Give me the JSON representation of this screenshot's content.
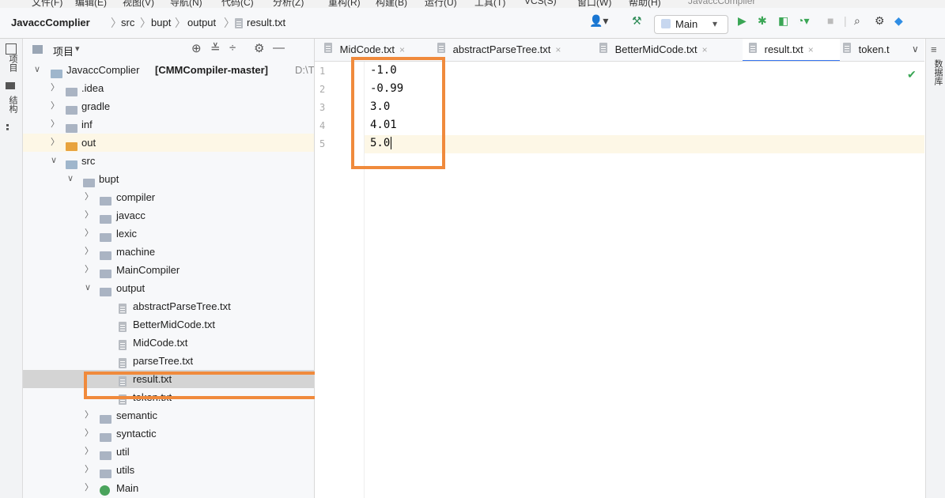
{
  "menubar": {
    "items": [
      "文件(F)",
      "编辑(E)",
      "视图(V)",
      "导航(N)",
      "代码(C)",
      "分析(Z)",
      "重构(R)",
      "构建(B)",
      "运行(U)",
      "工具(T)",
      "VCS(S)",
      "窗口(W)",
      "帮助(H)"
    ],
    "app_title": "JavaccComplier"
  },
  "breadcrumb": {
    "project": "JavaccComplier",
    "items": [
      "src",
      "bupt",
      "output"
    ],
    "file": "result.txt"
  },
  "toolbar": {
    "run_config": "Main",
    "run_config_arrow": "▾"
  },
  "left_strip": {
    "project_label": "项目",
    "structure_label": "结构"
  },
  "right_strip": {
    "database_label": "数据库"
  },
  "project_panel": {
    "title": "项目",
    "title_arrow": "▾",
    "root_label": "JavaccComplier",
    "root_module": "[CMMCompiler-master]",
    "root_path": "D:\\T",
    "tree": [
      {
        "label": ".idea",
        "type": "folder",
        "expanded": false
      },
      {
        "label": "gradle",
        "type": "folder",
        "expanded": false
      },
      {
        "label": "inf",
        "type": "folder",
        "expanded": false
      },
      {
        "label": "out",
        "type": "folder-orange",
        "expanded": false
      },
      {
        "label": "src",
        "type": "folder-blue",
        "expanded": true
      },
      {
        "label": "bupt",
        "type": "package",
        "expanded": true
      },
      {
        "label": "compiler",
        "type": "package",
        "expanded": false
      },
      {
        "label": "javacc",
        "type": "package",
        "expanded": false
      },
      {
        "label": "lexic",
        "type": "package",
        "expanded": false
      },
      {
        "label": "machine",
        "type": "package",
        "expanded": false
      },
      {
        "label": "MainCompiler",
        "type": "package",
        "expanded": false
      },
      {
        "label": "output",
        "type": "package",
        "expanded": true
      },
      {
        "label": "abstractParseTree.txt",
        "type": "file"
      },
      {
        "label": "BetterMidCode.txt",
        "type": "file"
      },
      {
        "label": "MidCode.txt",
        "type": "file"
      },
      {
        "label": "parseTree.txt",
        "type": "file"
      },
      {
        "label": "result.txt",
        "type": "file",
        "selected": true
      },
      {
        "label": "token.txt",
        "type": "file"
      },
      {
        "label": "semantic",
        "type": "package",
        "expanded": false
      },
      {
        "label": "syntactic",
        "type": "package",
        "expanded": false
      },
      {
        "label": "util",
        "type": "package",
        "expanded": false
      },
      {
        "label": "utils",
        "type": "package",
        "expanded": false
      },
      {
        "label": "Main",
        "type": "class",
        "expanded": false
      }
    ]
  },
  "tabs": [
    {
      "label": "MidCode.txt",
      "active": false
    },
    {
      "label": "abstractParseTree.txt",
      "active": false
    },
    {
      "label": "BetterMidCode.txt",
      "active": false
    },
    {
      "label": "result.txt",
      "active": true
    },
    {
      "label": "token.t",
      "active": false
    }
  ],
  "editor": {
    "lines": [
      {
        "num": "1",
        "text": "-1.0"
      },
      {
        "num": "2",
        "text": "-0.99"
      },
      {
        "num": "3",
        "text": "3.0"
      },
      {
        "num": "4",
        "text": "4.01"
      },
      {
        "num": "5",
        "text": "5.0"
      }
    ]
  }
}
